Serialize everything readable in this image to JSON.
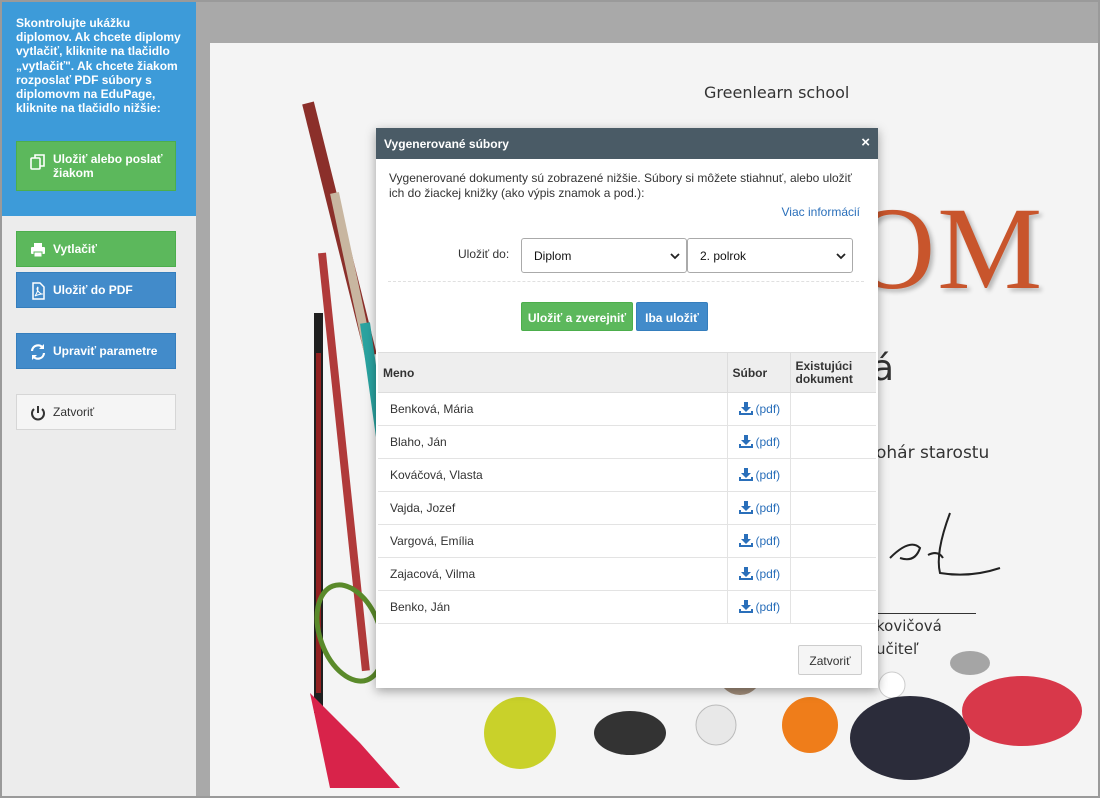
{
  "sidebar": {
    "instructions": "Skontrolujte ukážku diplomov. Ak chcete diplomy vytlačiť, kliknite na tlačidlo „vytlačiť\". Ak chcete žiakom rozposlať PDF súbory s diplomovm na EduPage, kliknite na tlačidlo nižšie:",
    "save_send_label": "Uložiť alebo poslať žiakom",
    "print_label": "Vytlačiť",
    "save_pdf_label": "Uložiť do PDF",
    "edit_params_label": "Upraviť parametre",
    "close_label": "Zatvoriť"
  },
  "diploma": {
    "school": "Greenlearn school",
    "title_visible": "OM",
    "name_visible": "á",
    "cup_visible": "ohár starostu",
    "teacher_visible": "kovičová",
    "role_visible": "učiteľ"
  },
  "modal": {
    "title": "Vygenerované súbory",
    "close_icon": "×",
    "description": "Vygenerované dokumenty sú zobrazené nižšie. Súbory si môžete stiahnuť, alebo uložiť ich do žiackej knižky (ako výpis znamok a pod.):",
    "more_info": "Viac informácií",
    "save_to_label": "Uložiť do:",
    "select_type": "Diplom",
    "select_term": "2. polrok",
    "save_publish_label": "Uložiť a zverejniť",
    "save_only_label": "Iba uložiť",
    "table": {
      "col_name": "Meno",
      "col_file": "Súbor",
      "col_existing": "Existujúci dokument",
      "rows": [
        {
          "name": "Benková, Mária",
          "file": "(pdf)"
        },
        {
          "name": "Blaho, Ján",
          "file": "(pdf)"
        },
        {
          "name": "Kováčová, Vlasta",
          "file": "(pdf)"
        },
        {
          "name": "Vajda, Jozef",
          "file": "(pdf)"
        },
        {
          "name": "Vargová, Emília",
          "file": "(pdf)"
        },
        {
          "name": "Zajacová, Vilma",
          "file": "(pdf)"
        },
        {
          "name": "Benko, Ján",
          "file": "(pdf)"
        }
      ]
    },
    "close_label": "Zatvoriť"
  },
  "colors": {
    "sidebar_blue": "#3d9bd9",
    "green": "#5cb85c",
    "blue": "#428bca",
    "modal_header": "#4a5b66",
    "title_orange": "#c8552c"
  }
}
